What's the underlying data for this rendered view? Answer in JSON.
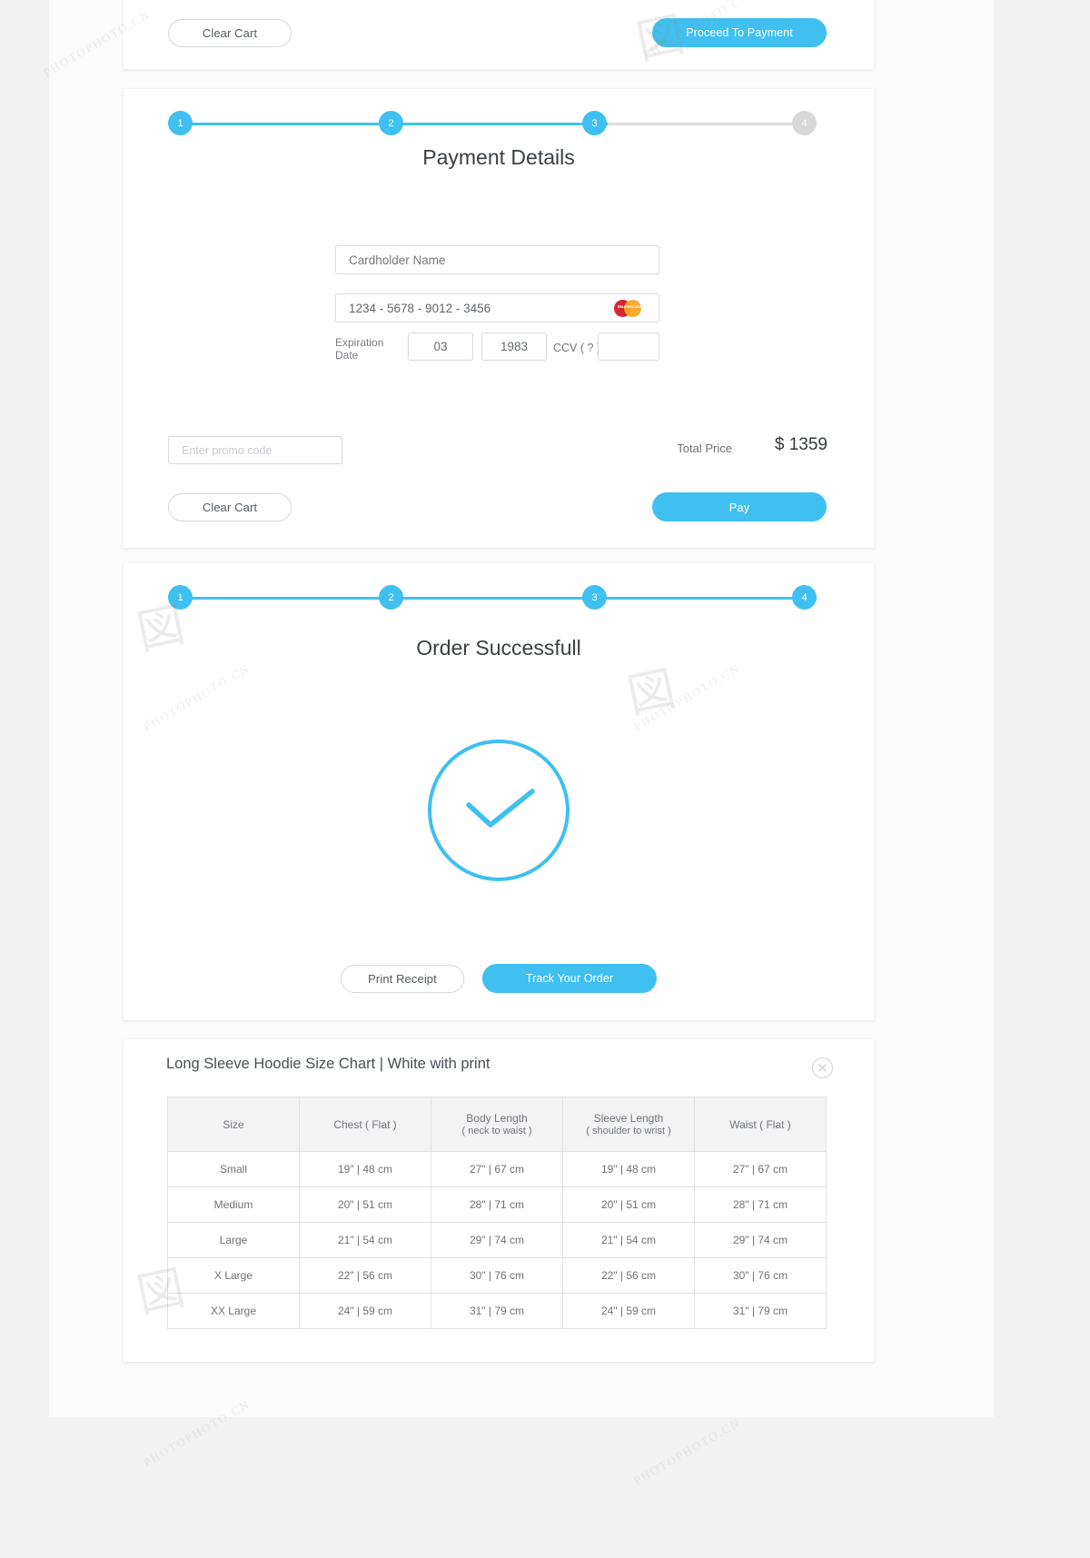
{
  "cart_footer": {
    "clear_cart_label": "Clear Cart",
    "proceed_label": "Proceed To Payment"
  },
  "payment": {
    "title": "Payment Details",
    "steps": [
      "1",
      "2",
      "3",
      "4"
    ],
    "cardholder_placeholder": "Cardholder Name",
    "card_number": "1234 - 5678 - 9012 - 3456",
    "card_brand_icon": "mastercard-icon",
    "card_brand_text": "MasterCard",
    "expiration_label": "Expiration Date",
    "expiration_month": "03",
    "expiration_year": "1983",
    "ccv_label": "CCV ( ? )",
    "ccv_value": "",
    "promo_placeholder": "Enter promo code",
    "total_label": "Total Price",
    "total_value": "$ 1359",
    "clear_cart_label": "Clear Cart",
    "pay_label": "Pay"
  },
  "success": {
    "title": "Order Successfull",
    "steps": [
      "1",
      "2",
      "3",
      "4"
    ],
    "check_icon": "check-circle-icon",
    "print_receipt_label": "Print Receipt",
    "track_order_label": "Track Your Order"
  },
  "size_chart": {
    "title": "Long Sleeve Hoodie Size Chart | White with print",
    "close_icon": "close-icon",
    "columns": [
      {
        "main": "Size",
        "sub": ""
      },
      {
        "main": "Chest ( Flat )",
        "sub": ""
      },
      {
        "main": "Body Length",
        "sub": "( neck to waist )"
      },
      {
        "main": "Sleeve Length",
        "sub": "( shoulder to wrist )"
      },
      {
        "main": "Waist ( Flat )",
        "sub": ""
      }
    ],
    "rows": [
      [
        "Small",
        "19\" | 48 cm",
        "27\" | 67 cm",
        "19\" | 48 cm",
        "27\" | 67 cm"
      ],
      [
        "Medium",
        "20\" | 51 cm",
        "28\" | 71 cm",
        "20\" | 51 cm",
        "28\" | 71 cm"
      ],
      [
        "Large",
        "21\" | 54 cm",
        "29\" | 74 cm",
        "21\" | 54 cm",
        "29\" | 74 cm"
      ],
      [
        "X Large",
        "22\" | 56 cm",
        "30\" | 76 cm",
        "22\" | 56 cm",
        "30\" | 76 cm"
      ],
      [
        "XX Large",
        "24\" | 59 cm",
        "31\" | 79 cm",
        "24\" | 59 cm",
        "31\" | 79 cm"
      ]
    ]
  },
  "colors": {
    "accent": "#3fc0f0",
    "step_inactive": "#d8d8d8",
    "border": "#d7d9dc",
    "text": "#6e7277"
  },
  "watermark": {
    "text": "PHOTOPHOTO.CN"
  }
}
